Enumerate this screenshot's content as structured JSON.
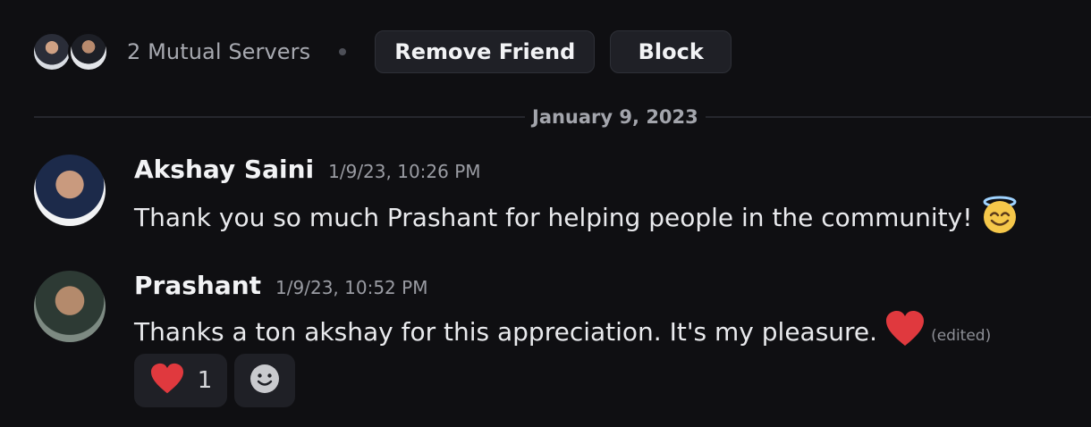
{
  "profile_actions": {
    "mutual_servers_text": "2 Mutual Servers",
    "remove_friend_label": "Remove Friend",
    "block_label": "Block"
  },
  "divider": {
    "date": "January 9, 2023"
  },
  "messages": [
    {
      "author": "Akshay Saini",
      "timestamp": "1/9/23, 10:26 PM",
      "text": "Thank you so much Prashant for helping people in the community!",
      "emoji": "smiling-face-with-halo-icon"
    },
    {
      "author": "Prashant",
      "timestamp": "1/9/23, 10:52 PM",
      "text": "Thanks a ton akshay for this appreciation. It's my pleasure.",
      "emoji": "red-heart-icon",
      "edited_label": "(edited)"
    }
  ],
  "reactions": [
    {
      "emoji": "red-heart-icon",
      "count": "1"
    }
  ],
  "colors": {
    "background": "#0f0f12",
    "button_bg": "#1f2026",
    "heart": "#e0393e",
    "muted_text": "#9a9ca3"
  }
}
